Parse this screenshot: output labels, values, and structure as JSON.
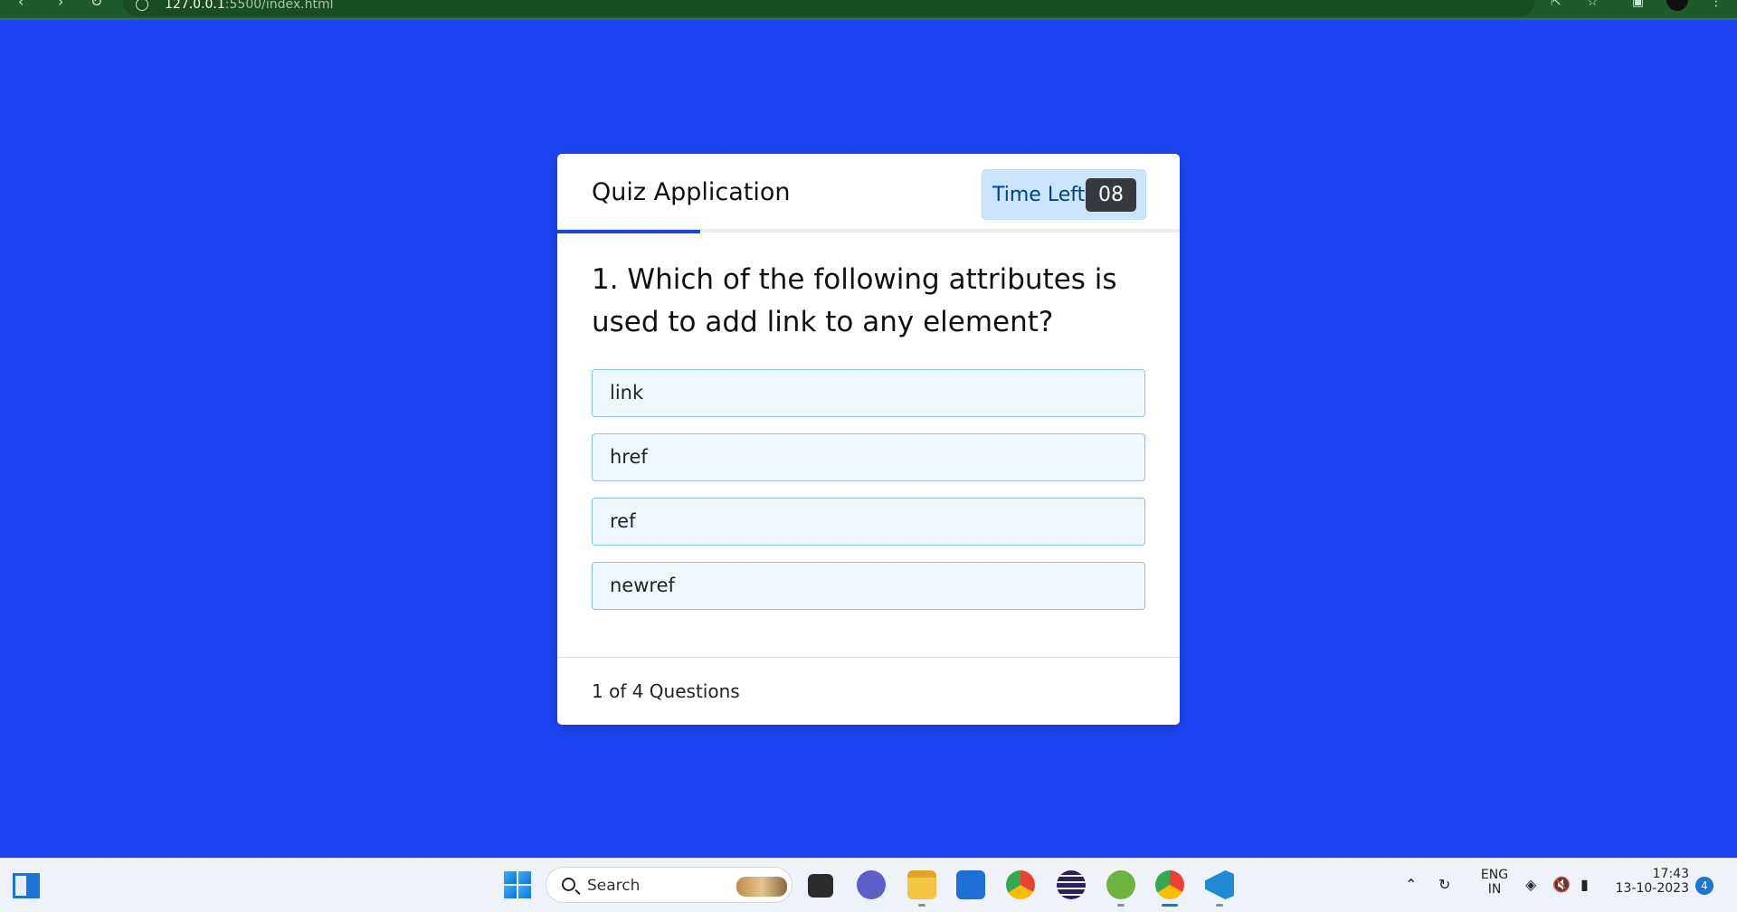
{
  "browser": {
    "url_host": "127.0.0.1",
    "url_path": ":5500/index.html"
  },
  "quiz": {
    "title": "Quiz Application",
    "timer_label": "Time Left",
    "timer_value": "08",
    "question": "1. Which of the following attributes is used to add link to any element?",
    "options": [
      "link",
      "href",
      "ref",
      "newref"
    ],
    "footer": "1 of 4 Questions",
    "accent_color": "#2046d8",
    "background_color": "#1b45f0"
  },
  "taskbar": {
    "search_placeholder": "Search",
    "lang_top": "ENG",
    "lang_bottom": "IN",
    "time": "17:43",
    "date": "13-10-2023",
    "notification_count": "4",
    "apps": [
      "task-view",
      "teams-chat",
      "file-explorer",
      "microsoft-store",
      "chrome",
      "eclipse",
      "spring-tool",
      "chrome-active",
      "vscode"
    ]
  }
}
